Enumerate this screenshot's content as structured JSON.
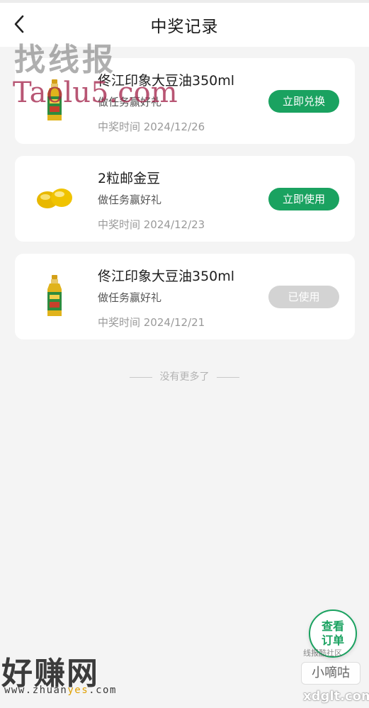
{
  "header": {
    "title": "中奖记录",
    "back_icon": "chevron-left-icon"
  },
  "records": [
    {
      "product_name": "佟江印象大豆油350ml",
      "description": "做任务赢好礼",
      "time_text": "中奖时间 2024/12/26",
      "action_label": "立即兑换",
      "action_state": "active",
      "thumbnail_icon": "oil-bottle-icon"
    },
    {
      "product_name": "2粒邮金豆",
      "description": "做任务赢好礼",
      "time_text": "中奖时间 2024/12/23",
      "action_label": "立即使用",
      "action_state": "active",
      "thumbnail_icon": "golden-beans-icon"
    },
    {
      "product_name": "佟江印象大豆油350ml",
      "description": "做任务赢好礼",
      "time_text": "中奖时间 2024/12/21",
      "action_label": "已使用",
      "action_state": "used",
      "thumbnail_icon": "oil-bottle-icon"
    }
  ],
  "footer": {
    "no_more_text": "没有更多了"
  },
  "fab": {
    "line1": "查看",
    "line2": "订单"
  },
  "watermarks": {
    "top_cn": "找线报",
    "top_en": "Taolu5.com",
    "bottom_cn": "好赚网",
    "bottom_url_a": "www.zhuan",
    "bottom_url_b": "yes",
    "bottom_url_c": ".com",
    "community": "线报酷社区",
    "badge": "小嘀咕",
    "site": "xdglt.com"
  },
  "colors": {
    "accent_green": "#1aa260",
    "used_gray": "#d3d3d3",
    "page_bg": "#f4f4f4"
  }
}
